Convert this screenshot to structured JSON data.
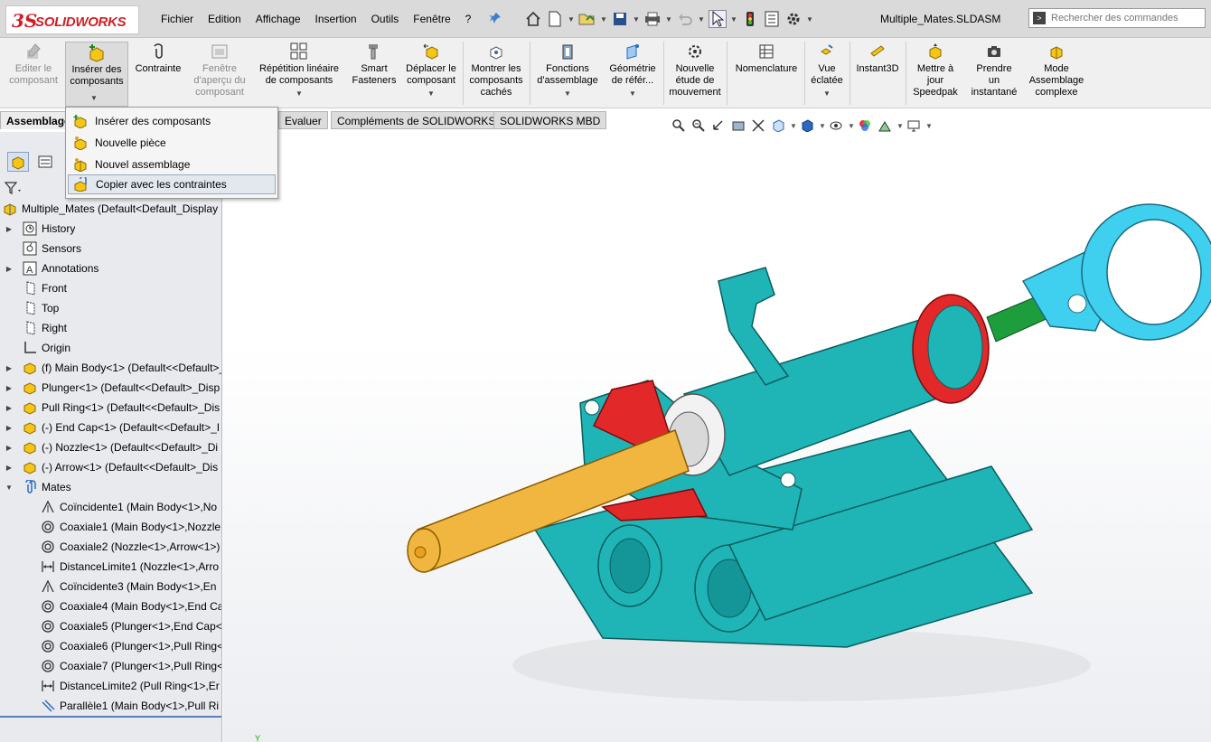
{
  "app": {
    "brand_ds": "3S",
    "brand_name": "SOLIDWORKS",
    "document_title": "Multiple_Mates.SLDASM"
  },
  "menubar": {
    "items": [
      "Fichier",
      "Edition",
      "Affichage",
      "Insertion",
      "Outils",
      "Fenêtre",
      "?"
    ]
  },
  "search": {
    "placeholder": "Rechercher des commandes"
  },
  "ribbon": {
    "buttons": [
      {
        "label": "Editer le\ncomposant",
        "icon": "edit-component-icon",
        "disabled": true
      },
      {
        "label": "Insérer des\ncomposants",
        "icon": "insert-components-icon",
        "disabled": false,
        "dropdown": true
      },
      {
        "label": "Contrainte",
        "icon": "mate-icon",
        "disabled": false
      },
      {
        "label": "Fenêtre\nd'aperçu du\ncomposant",
        "icon": "component-preview-icon",
        "disabled": true
      },
      {
        "label": "Répétition linéaire\nde composants",
        "icon": "linear-pattern-icon",
        "disabled": false,
        "dropdown": true
      },
      {
        "label": "Smart\nFasteners",
        "icon": "smart-fasteners-icon",
        "disabled": false
      },
      {
        "label": "Déplacer le\ncomposant",
        "icon": "move-component-icon",
        "disabled": false,
        "dropdown": true
      },
      {
        "label": "Montrer les\ncomposants\ncachés",
        "icon": "show-hidden-icon",
        "disabled": false
      },
      {
        "label": "Fonctions\nd'assemblage",
        "icon": "assembly-features-icon",
        "disabled": false,
        "dropdown": true
      },
      {
        "label": "Géométrie\nde référ...",
        "icon": "reference-geometry-icon",
        "disabled": false,
        "dropdown": true
      },
      {
        "label": "Nouvelle\nétude de\nmouvement",
        "icon": "motion-study-icon",
        "disabled": false
      },
      {
        "label": "Nomenclature",
        "icon": "bom-icon",
        "disabled": false
      },
      {
        "label": "Vue\néclatée",
        "icon": "exploded-view-icon",
        "disabled": false,
        "dropdown": true
      },
      {
        "label": "Instant3D",
        "icon": "instant3d-icon",
        "disabled": false
      },
      {
        "label": "Mettre à\njour\nSpeedpak",
        "icon": "speedpak-icon",
        "disabled": false
      },
      {
        "label": "Prendre\nun\ninstantané",
        "icon": "snapshot-icon",
        "disabled": false
      },
      {
        "label": "Mode\nAssemblage\ncomplexe",
        "icon": "large-assembly-icon",
        "disabled": false
      }
    ]
  },
  "tabs": [
    "Assemblage",
    "Evaluer",
    "Compléments de SOLIDWORKS",
    "SOLIDWORKS MBD"
  ],
  "dropdown": {
    "items": [
      {
        "label": "Insérer des composants",
        "icon": "insert-components-icon"
      },
      {
        "label": "Nouvelle pièce",
        "icon": "new-part-icon"
      },
      {
        "label": "Nouvel assemblage",
        "icon": "new-assembly-icon"
      },
      {
        "label": "Copier avec les contraintes",
        "icon": "copy-with-mates-icon"
      }
    ]
  },
  "tree": {
    "root": "Multiple_Mates  (Default<Default_Display",
    "items": [
      {
        "label": "History",
        "icon": "history-icon",
        "expandable": true
      },
      {
        "label": "Sensors",
        "icon": "sensors-icon",
        "expandable": false
      },
      {
        "label": "Annotations",
        "icon": "annotations-icon",
        "expandable": true
      },
      {
        "label": "Front",
        "icon": "plane-icon",
        "expandable": false
      },
      {
        "label": "Top",
        "icon": "plane-icon",
        "expandable": false
      },
      {
        "label": "Right",
        "icon": "plane-icon",
        "expandable": false
      },
      {
        "label": "Origin",
        "icon": "origin-icon",
        "expandable": false
      },
      {
        "label": "(f) Main Body<1> (Default<<Default>_",
        "icon": "part-icon",
        "expandable": true
      },
      {
        "label": "Plunger<1> (Default<<Default>_Disp",
        "icon": "part-icon",
        "expandable": true
      },
      {
        "label": "Pull Ring<1> (Default<<Default>_Dis",
        "icon": "part-icon",
        "expandable": true
      },
      {
        "label": "(-) End Cap<1> (Default<<Default>_I",
        "icon": "part-icon",
        "expandable": true
      },
      {
        "label": "(-) Nozzle<1> (Default<<Default>_Di",
        "icon": "part-icon",
        "expandable": true
      },
      {
        "label": "(-) Arrow<1> (Default<<Default>_Dis",
        "icon": "part-icon",
        "expandable": true
      },
      {
        "label": "Mates",
        "icon": "mates-folder-icon",
        "expandable": true,
        "expanded": true
      }
    ],
    "mates": [
      {
        "label": "Coïncidente1 (Main Body<1>,No",
        "icon": "coincident-icon"
      },
      {
        "label": "Coaxiale1 (Main Body<1>,Nozzle",
        "icon": "concentric-icon"
      },
      {
        "label": "Coaxiale2 (Nozzle<1>,Arrow<1>)",
        "icon": "concentric-icon"
      },
      {
        "label": "DistanceLimite1 (Nozzle<1>,Arro",
        "icon": "limit-distance-icon"
      },
      {
        "label": "Coïncidente3 (Main Body<1>,En",
        "icon": "coincident-icon"
      },
      {
        "label": "Coaxiale4 (Main Body<1>,End Ca",
        "icon": "concentric-icon"
      },
      {
        "label": "Coaxiale5 (Plunger<1>,End Cap<",
        "icon": "concentric-icon"
      },
      {
        "label": "Coaxiale6 (Plunger<1>,Pull Ring<",
        "icon": "concentric-icon"
      },
      {
        "label": "Coaxiale7 (Plunger<1>,Pull Ring<",
        "icon": "concentric-icon"
      },
      {
        "label": "DistanceLimite2 (Pull Ring<1>,Er",
        "icon": "limit-distance-icon"
      },
      {
        "label": "Parallèle1 (Main Body<1>,Pull Ri",
        "icon": "parallel-icon"
      }
    ]
  },
  "axis_label": "Y",
  "colors": {
    "brand_red": "#d31e25",
    "body_teal": "#1fb5b6",
    "cap_red": "#e3282a",
    "ring_cyan": "#3fd0ef",
    "arrow_yellow": "#f0b640",
    "rod_green": "#1e9d3c"
  }
}
